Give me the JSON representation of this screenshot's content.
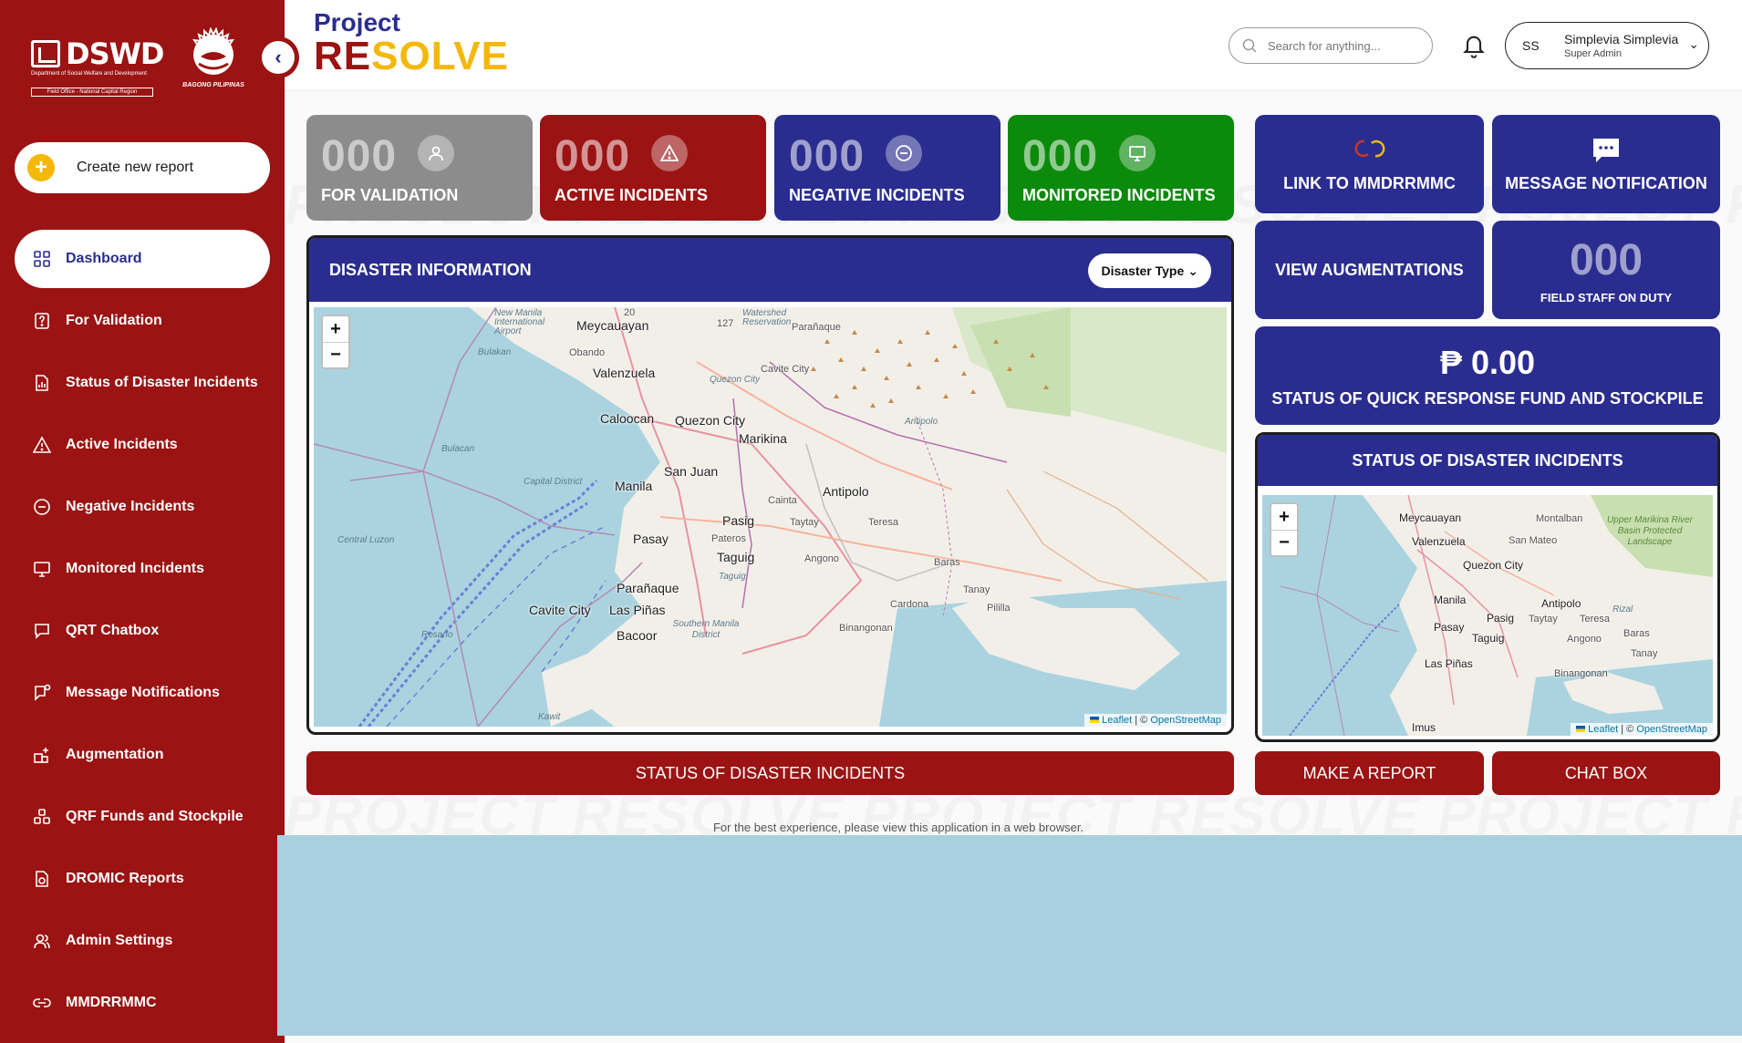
{
  "sidebar": {
    "logo_dswd": "DSWD",
    "logo_dswd_sub": "Department of Social Welfare and Development",
    "logo_dswd_field": "Field Office - National Capital Region",
    "logo_bagong": "BAGONG PILIPINAS",
    "collapse_icon": "chevron-left-icon",
    "create_label": "Create new report",
    "items": [
      {
        "label": "Dashboard",
        "icon": "grid-icon",
        "active": true
      },
      {
        "label": "For Validation",
        "icon": "document-question-icon"
      },
      {
        "label": "Status of Disaster Incidents",
        "icon": "document-chart-icon"
      },
      {
        "label": "Active Incidents",
        "icon": "warning-icon"
      },
      {
        "label": "Negative Incidents",
        "icon": "minus-circle-icon"
      },
      {
        "label": "Monitored Incidents",
        "icon": "monitor-icon"
      },
      {
        "label": "QRT Chatbox",
        "icon": "chat-icon"
      },
      {
        "label": "Message Notifications",
        "icon": "message-flag-icon"
      },
      {
        "label": "Augmentation",
        "icon": "boxes-plus-icon"
      },
      {
        "label": "QRF Funds and Stockpile",
        "icon": "stockpile-icon"
      },
      {
        "label": "DROMIC Reports",
        "icon": "report-icon"
      },
      {
        "label": "Admin Settings",
        "icon": "users-icon"
      },
      {
        "label": "MMDRRMMC",
        "icon": "link-icon"
      }
    ]
  },
  "header": {
    "brand_project": "Project",
    "brand_re": "RE",
    "brand_solve": "SOLVE",
    "search_placeholder": "Search for anything...",
    "user_initials": "SS",
    "user_name": "Simplevia Simplevia",
    "user_role": "Super Admin"
  },
  "stats": [
    {
      "count": "000",
      "label": "FOR VALIDATION",
      "color": "#8c8c8c",
      "icon": "user-icon"
    },
    {
      "count": "000",
      "label": "ACTIVE INCIDENTS",
      "color": "#9b1313",
      "icon": "warning-icon"
    },
    {
      "count": "000",
      "label": "NEGATIVE INCIDENTS",
      "color": "#2a2d8f",
      "icon": "minus-circle-icon"
    },
    {
      "count": "000",
      "label": "MONITORED INCIDENTS",
      "color": "#0c8a0c",
      "icon": "monitor-icon"
    }
  ],
  "disaster_info": {
    "title": "DISASTER INFORMATION",
    "filter_label": "Disaster Type"
  },
  "map": {
    "zoom_in": "+",
    "zoom_out": "−",
    "attrib_leaflet": "Leaflet",
    "attrib_sep": "| ©",
    "attrib_osm": "OpenStreetMap",
    "labels": [
      "Meycauayan",
      "Valenzuela",
      "Caloocan",
      "Quezon City",
      "Marikina",
      "San Juan",
      "Manila",
      "Antipolo",
      "Pasig",
      "Taguig",
      "Pasay",
      "Parañaque",
      "Cavite City",
      "Las Piñas",
      "Bacoor",
      "Montalban",
      "San Mateo",
      "Cainta",
      "Taytay",
      "Teresa",
      "Angono",
      "Baras",
      "Tanay",
      "Cardona",
      "Pililla",
      "Binangonan",
      "Obando",
      "Pateros"
    ],
    "water_labels": [
      "New Manila International Airport",
      "Watershed Reservation",
      "Bulakan",
      "Bulacan",
      "Capital District",
      "Central Luzon",
      "Rosario",
      "Southern Manila District",
      "Quezon City",
      "Antipolo",
      "Taguig",
      "Kawit"
    ],
    "small_labels": [
      "Meycauayan",
      "Montalban",
      "Valenzuela",
      "San Mateo",
      "Upper Marikina River Basin Protected Landscape",
      "Quezon City",
      "Manila",
      "Antipolo",
      "Pasig",
      "Taytay",
      "Teresa",
      "Rizal",
      "Pasay",
      "Taguig",
      "Angono",
      "Baras",
      "Tanay",
      "Las Piñas",
      "Binangonan",
      "Imus"
    ],
    "route_numbers": [
      "20",
      "127"
    ]
  },
  "right_tiles": {
    "link_mm": "LINK TO MMDRRMMC",
    "message_notif": "MESSAGE NOTIFICATION",
    "view_aug": "VIEW AUGMENTATIONS",
    "field_staff_count": "000",
    "field_staff_label": "FIELD STAFF ON DUTY",
    "qrf_amount": "₱ 0.00",
    "qrf_label": "STATUS OF QUICK RESPONSE FUND AND STOCKPILE",
    "status_title": "STATUS OF DISASTER INCIDENTS"
  },
  "buttons": {
    "status_incidents": "STATUS OF DISASTER INCIDENTS",
    "make_report": "MAKE A REPORT",
    "chat_box": "CHAT BOX"
  },
  "watermark": "PROJECT RESOLVE",
  "footer_note": "For the best experience, please view this application in a web browser."
}
